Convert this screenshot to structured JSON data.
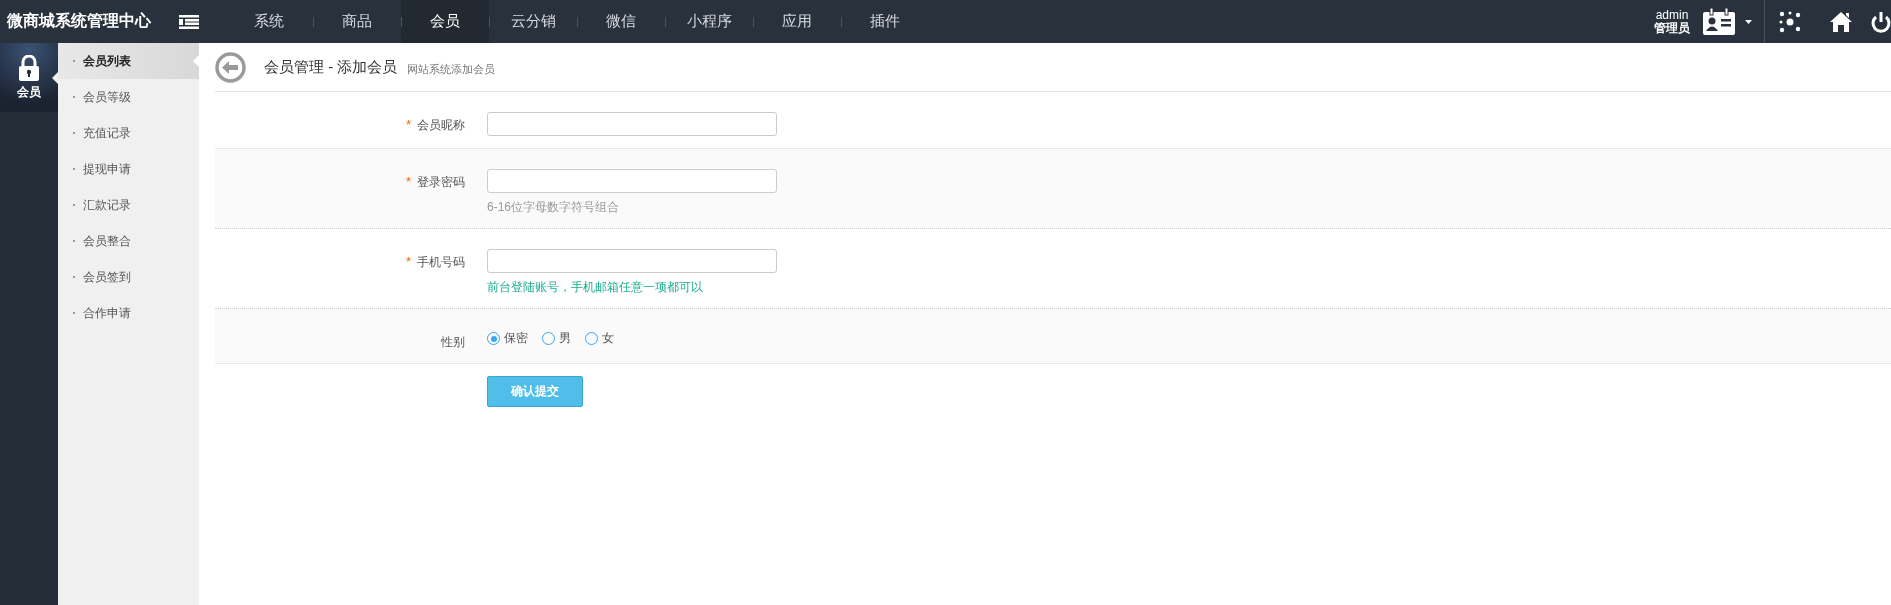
{
  "brand": "微商城系统管理中心",
  "nav": [
    {
      "label": "系统",
      "selected": false
    },
    {
      "label": "商品",
      "selected": false
    },
    {
      "label": "会员",
      "selected": true
    },
    {
      "label": "云分销",
      "selected": false
    },
    {
      "label": "微信",
      "selected": false
    },
    {
      "label": "小程序",
      "selected": false
    },
    {
      "label": "应用",
      "selected": false
    },
    {
      "label": "插件",
      "selected": false
    }
  ],
  "user": {
    "name": "admin",
    "role": "管理员"
  },
  "rail": [
    {
      "label": "会员",
      "selected": true
    }
  ],
  "submenu": [
    {
      "label": "会员列表",
      "selected": true
    },
    {
      "label": "会员等级",
      "selected": false
    },
    {
      "label": "充值记录",
      "selected": false
    },
    {
      "label": "提现申请",
      "selected": false
    },
    {
      "label": "汇款记录",
      "selected": false
    },
    {
      "label": "会员整合",
      "selected": false
    },
    {
      "label": "会员签到",
      "selected": false
    },
    {
      "label": "合作申请",
      "selected": false
    }
  ],
  "header": {
    "title": "会员管理 - 添加会员",
    "subtitle": "网站系统添加会员"
  },
  "form": {
    "fields": [
      {
        "kind": "text",
        "label": "会员昵称",
        "required_mark": "*"
      },
      {
        "kind": "text",
        "label": "登录密码",
        "required_mark": "*",
        "hint": {
          "text": "6-16位字母数字符号组合",
          "color": "#999999"
        }
      },
      {
        "kind": "text",
        "label": "手机号码",
        "required_mark": "*",
        "hint": {
          "text": "前台登陆账号，手机邮箱任意一项都可以",
          "color": "#1aad8c"
        }
      },
      {
        "kind": "radio",
        "label": "性别",
        "options": [
          {
            "label": "保密",
            "selected": true
          },
          {
            "label": "男",
            "selected": false
          },
          {
            "label": "女",
            "selected": false
          }
        ]
      }
    ],
    "submit": "确认提交"
  }
}
